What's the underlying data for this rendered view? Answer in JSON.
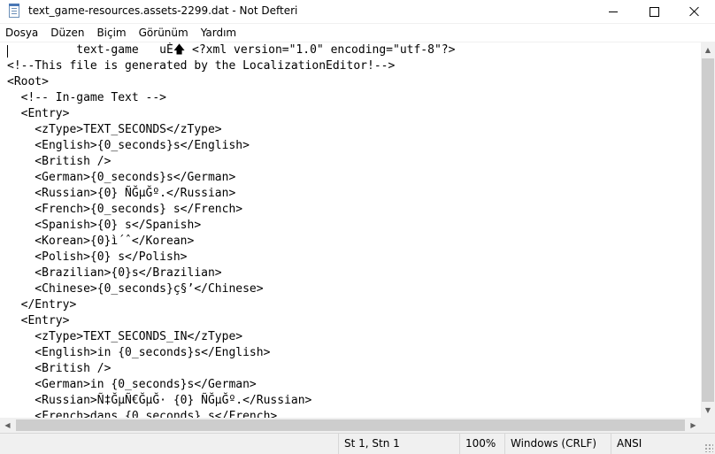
{
  "window": {
    "title": "text_game-resources.assets-2299.dat - Not Defteri",
    "icon": "notepad-icon",
    "controls": {
      "minimize": "minimize-icon",
      "maximize": "maximize-icon",
      "close": "close-icon"
    }
  },
  "menu": {
    "items": [
      {
        "label": "Dosya"
      },
      {
        "label": "Düzen"
      },
      {
        "label": "Biçim"
      },
      {
        "label": "Görünüm"
      },
      {
        "label": "Yardım"
      }
    ]
  },
  "editor": {
    "lines": [
      "          text-game   uÈ🡅 <?xml version=\"1.0\" encoding=\"utf-8\"?>",
      "<!--This file is generated by the LocalizationEditor!-->",
      "<Root>",
      "  <!-- In-game Text -->",
      "  <Entry>",
      "    <zType>TEXT_SECONDS</zType>",
      "    <English>{0_seconds}s</English>",
      "    <British />",
      "    <German>{0_seconds}s</German>",
      "    <Russian>{0} ÑĞµĞº.</Russian>",
      "    <French>{0_seconds} s</French>",
      "    <Spanish>{0} s</Spanish>",
      "    <Korean>{0}ì´ˆ</Korean>",
      "    <Polish>{0} s</Polish>",
      "    <Brazilian>{0}s</Brazilian>",
      "    <Chinese>{0_seconds}ç§’</Chinese>",
      "  </Entry>",
      "  <Entry>",
      "    <zType>TEXT_SECONDS_IN</zType>",
      "    <English>in {0_seconds}s</English>",
      "    <British />",
      "    <German>in {0_seconds}s</German>",
      "    <Russian>Ñ‡ĞµÑ€ĞµĞ· {0} ÑĞµĞº.</Russian>",
      "    <French>dans {0_seconds} s</French>"
    ]
  },
  "status": {
    "position": "St 1, Stn 1",
    "zoom": "100%",
    "line_ending": "Windows (CRLF)",
    "encoding": "ANSI"
  },
  "colors": {
    "background": "#ffffff",
    "chrome": "#f0f0f0",
    "scroll_thumb": "#cdcdcd"
  }
}
